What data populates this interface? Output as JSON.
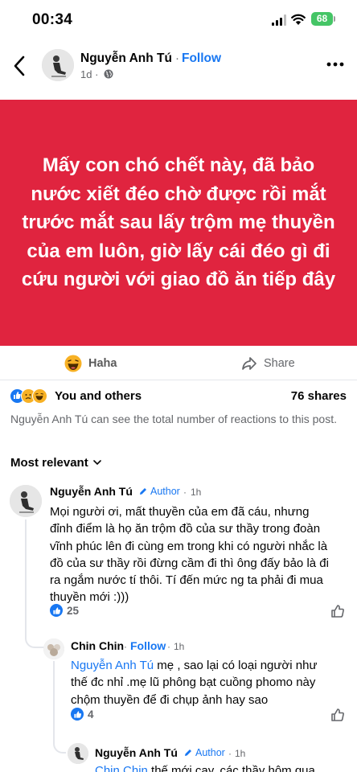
{
  "status_bar": {
    "time": "00:34",
    "battery": "68"
  },
  "post": {
    "author": "Nguyễn Anh Tú",
    "separator": "·",
    "follow_label": "Follow",
    "age": "1d ·",
    "text": "Mấy con chó chết này, đã bảo nước xiết đéo chờ được rồi mắt trước mắt sau lấy trộm mẹ thuyền của em luôn, giờ lấy cái đéo gì đi cứu người với giao đồ ăn tiếp đây",
    "banner_color": "#e0243f"
  },
  "actions": {
    "reaction_label": "Haha",
    "share_label": "Share"
  },
  "summary": {
    "reactions_label": "You and others",
    "shares": "76 shares",
    "notice": "Nguyễn Anh Tú can see the total number of reactions to this post."
  },
  "sort": {
    "label": "Most relevant"
  },
  "comments": [
    {
      "author": "Nguyễn Anh Tú",
      "badge": "Author",
      "separator": "·",
      "time": "1h",
      "text": "Mọi người ơi, mất thuyền của em đã cáu, nhưng đỉnh điểm là họ ăn trộm đồ của sư thầy trong đoàn vĩnh phúc lên đi cùng em trong khi có người nhắc là đồ của sư thầy rồi đừng cầm đi thì ông đấy bảo là đi ra ngắm nước tí thôi. Tí đến mức ng ta phải đi mua thuyền mới :)))",
      "likes": "25"
    },
    {
      "author": "Chin Chin",
      "follow_label": "Follow",
      "separator": "·",
      "time": "1h",
      "mention": "Nguyễn Anh Tú",
      "text": " mẹ , sao lại có loại người như thế đc nhỉ .mẹ lũ phông bạt cuồng phomo này chộm thuyền để đi chụp ảnh hay sao",
      "likes": "4"
    },
    {
      "author": "Nguyễn Anh Tú",
      "badge": "Author",
      "separator": "·",
      "time": "1h",
      "mention": "Chin Chin",
      "text": " thế mới cay, các thầy hôm qua"
    }
  ],
  "colors": {
    "accent": "#1877f2",
    "muted": "#65676b",
    "divider": "#e4e6eb"
  },
  "icons": [
    "back-arrow-icon",
    "globe-icon",
    "more-icon",
    "haha-emoji-icon",
    "share-arrow-icon",
    "like-icon",
    "sad-icon",
    "chevron-down-icon",
    "pencil-icon",
    "like-outline-icon"
  ]
}
